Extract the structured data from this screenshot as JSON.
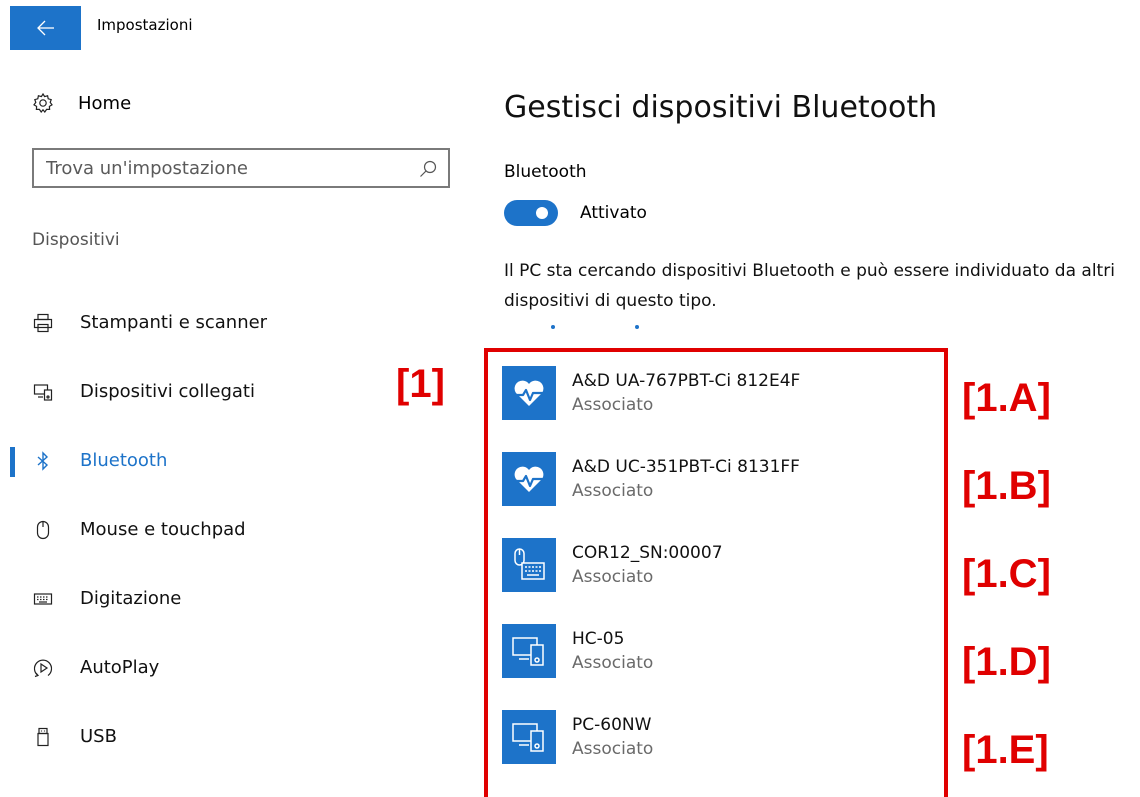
{
  "window": {
    "title": "Impostazioni",
    "back_icon": "arrow-left-icon",
    "accent": "#1d73c9"
  },
  "sidebar": {
    "home": {
      "label": "Home",
      "icon": "gear-icon"
    },
    "search": {
      "placeholder": "Trova un'impostazione",
      "value": "",
      "icon": "search-icon"
    },
    "section": "Dispositivi",
    "items": [
      {
        "label": "Stampanti e scanner",
        "icon": "printer-icon",
        "active": false
      },
      {
        "label": "Dispositivi collegati",
        "icon": "connected-devices-icon",
        "active": false
      },
      {
        "label": "Bluetooth",
        "icon": "bluetooth-icon",
        "active": true
      },
      {
        "label": "Mouse e touchpad",
        "icon": "mouse-icon",
        "active": false
      },
      {
        "label": "Digitazione",
        "icon": "keyboard-icon",
        "active": false
      },
      {
        "label": "AutoPlay",
        "icon": "autoplay-icon",
        "active": false
      },
      {
        "label": "USB",
        "icon": "usb-icon",
        "active": false
      }
    ]
  },
  "main": {
    "title": "Gestisci dispositivi Bluetooth",
    "bluetooth_label": "Bluetooth",
    "toggle": {
      "state": "on",
      "label": "Attivato"
    },
    "description": "Il PC sta cercando dispositivi Bluetooth e può essere individuato da altri dispositivi di questo tipo.",
    "devices": [
      {
        "name": "A&D UA-767PBT-Ci 812E4F",
        "status": "Associato",
        "icon": "heart-rate-icon"
      },
      {
        "name": "A&D UC-351PBT-Ci 8131FF",
        "status": "Associato",
        "icon": "heart-rate-icon"
      },
      {
        "name": "COR12_SN:00007",
        "status": "Associato",
        "icon": "mouse-keyboard-icon"
      },
      {
        "name": "HC-05",
        "status": "Associato",
        "icon": "pc-phone-icon"
      },
      {
        "name": "PC-60NW",
        "status": "Associato",
        "icon": "pc-phone-icon"
      }
    ]
  },
  "annotations": {
    "color": "#e00000",
    "group": "[1]",
    "items": [
      "[1.A]",
      "[1.B]",
      "[1.C]",
      "[1.D]",
      "[1.E]"
    ]
  }
}
